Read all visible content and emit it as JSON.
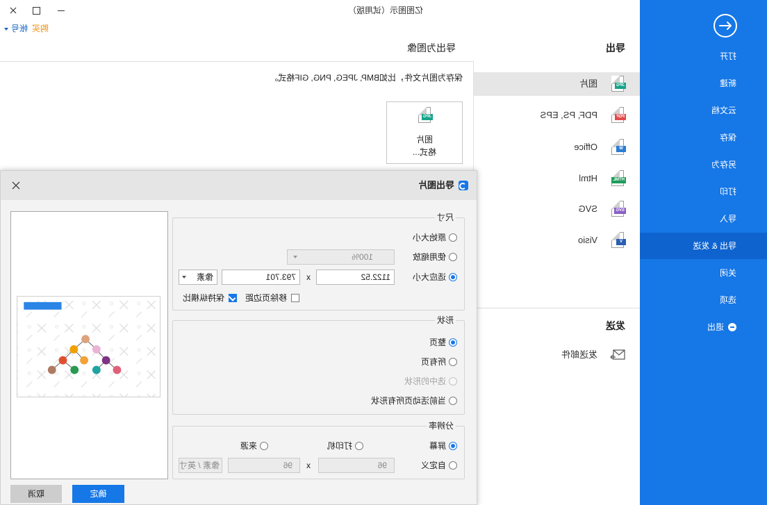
{
  "theme": {
    "accent": "#1677e6",
    "sidebar_active": "#0e63cf",
    "buy_color": "#ee8a00",
    "link_color": "#1565c0"
  },
  "window": {
    "title": "亿图图示（试用版）",
    "minimize_icon": "minimize-icon",
    "maximize_icon": "maximize-icon",
    "close_icon": "close-icon"
  },
  "account": {
    "buy": "购买",
    "account": "帐号"
  },
  "sidebar": {
    "back_icon": "back-arrow-icon",
    "items": [
      {
        "label": "打开"
      },
      {
        "label": "新建"
      },
      {
        "label": "云文档"
      },
      {
        "label": "保存"
      },
      {
        "label": "另存为"
      },
      {
        "label": "打印"
      },
      {
        "label": "导入"
      },
      {
        "label": "导出 & 发送",
        "active": true
      },
      {
        "label": "关闭"
      },
      {
        "label": "选项"
      },
      {
        "label": "退出",
        "icon": "exit-icon"
      }
    ]
  },
  "export": {
    "heading": "导出",
    "items": [
      {
        "label": "图片",
        "badge": "JPG",
        "icon": "jpg-file-icon",
        "selected": true
      },
      {
        "label": "PDF, PS, EPS",
        "badge": "PDF",
        "icon": "pdf-file-icon"
      },
      {
        "label": "Office",
        "badge": "W",
        "icon": "word-file-icon"
      },
      {
        "label": "Html",
        "badge": "HTML",
        "icon": "html-file-icon"
      },
      {
        "label": "SVG",
        "badge": "SVG",
        "icon": "svg-file-icon"
      },
      {
        "label": "Visio",
        "badge": "V",
        "icon": "visio-file-icon"
      }
    ],
    "send_heading": "发送",
    "send_items": [
      {
        "label": "发送邮件",
        "icon": "send-mail-icon"
      }
    ]
  },
  "content": {
    "heading": "导出为图像",
    "description": "保存为图片文件，比如BMP, JPEG, PNG, GIF格式。",
    "card": {
      "badge": "JPG",
      "line1": "图片",
      "line2": "格式..."
    }
  },
  "dialog": {
    "title": "导出图片",
    "size": {
      "legend": "尺寸",
      "original": "原始大小",
      "zoom": "使用缩放",
      "fit": "适应大小",
      "selected": "fit",
      "zoom_value": "100%",
      "width": "1122.52",
      "times": "x",
      "height": "793.701",
      "unit": "像素",
      "remove_margin": "移除页边距",
      "remove_margin_checked": false,
      "keep_ratio": "保持纵横比",
      "keep_ratio_checked": true
    },
    "shape": {
      "legend": "形状",
      "options": [
        "整页",
        "所有页",
        "选中的形状",
        "当前活动页所有形状"
      ],
      "selected": 0,
      "disabled": [
        2
      ]
    },
    "resolution": {
      "legend": "分辨率",
      "screen": "屏幕",
      "printer": "打印机",
      "source": "来源",
      "custom": "自定义",
      "selected": "screen",
      "dpi_x": "96",
      "times": "x",
      "dpi_y": "96",
      "unit": "像素 / 英寸"
    },
    "ok": "确定",
    "cancel": "取消"
  }
}
